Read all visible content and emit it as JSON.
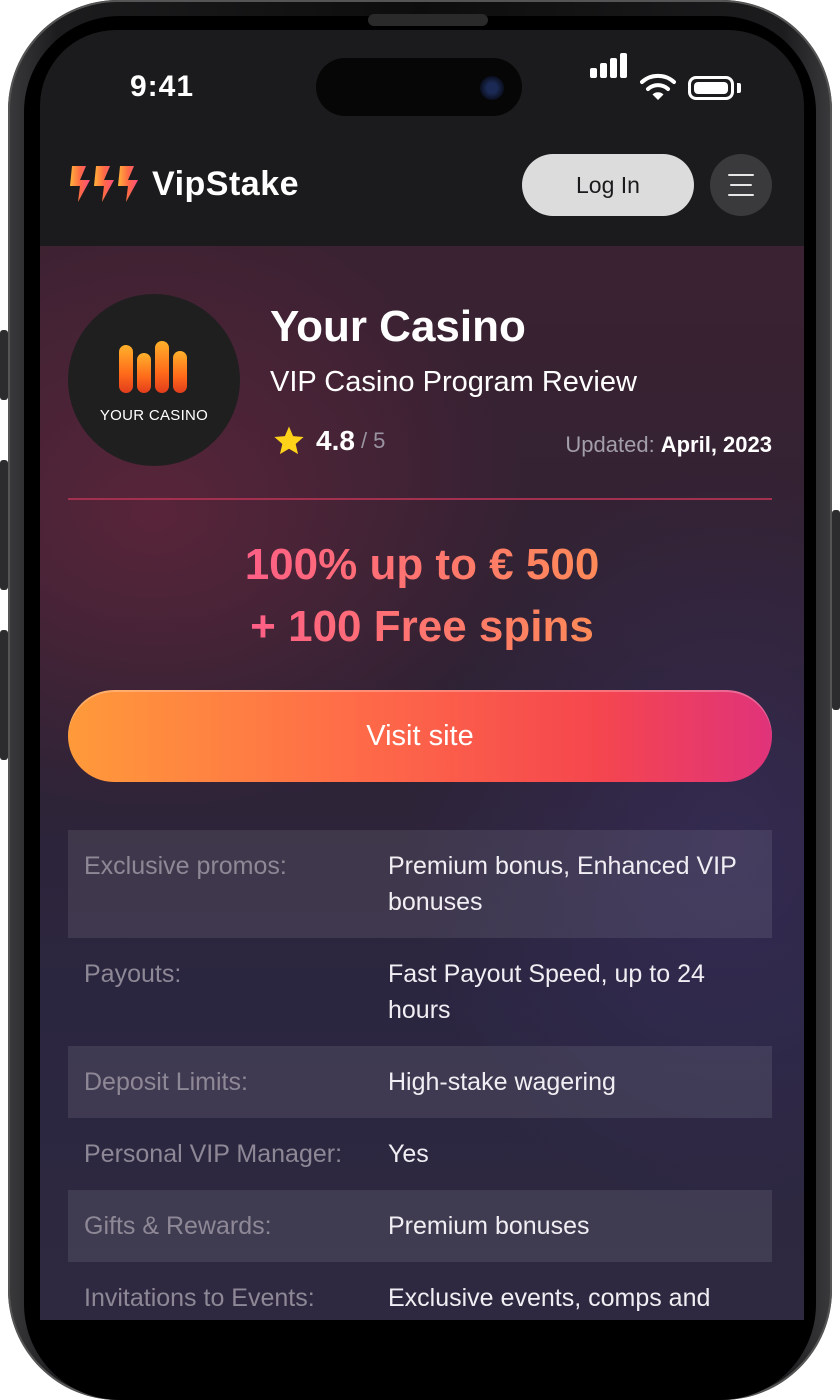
{
  "status_bar": {
    "time": "9:41"
  },
  "header": {
    "brand": "VipStake",
    "login_label": "Log In",
    "menu_icon": "hamburger-menu-icon"
  },
  "casino": {
    "logo_text": "YOUR CASINO",
    "name": "Your Casino",
    "subtitle": "VIP Casino Program Review",
    "rating": "4.8",
    "rating_max": "/ 5",
    "updated_label": "Updated:",
    "updated_value": "April, 2023"
  },
  "bonus": {
    "line1": "100% up to € 500",
    "line2": "+ 100 Free spins"
  },
  "cta": {
    "visit_label": "Visit site"
  },
  "details": [
    {
      "key": "Exclusive promos:",
      "value": "Premium bonus, Enhanced VIP bonuses"
    },
    {
      "key": "Payouts:",
      "value": "Fast Payout Speed, up to 24 hours"
    },
    {
      "key": "Deposit Limits:",
      "value": "High-stake wagering"
    },
    {
      "key": "Personal VIP Manager:",
      "value": "Yes"
    },
    {
      "key": "Gifts & Rewards:",
      "value": "Premium bonuses"
    },
    {
      "key": "Invitations to Events:",
      "value": "Exclusive events, comps and"
    }
  ],
  "colors": {
    "accent_orange": "#ff9a3a",
    "accent_pink": "#e0337a",
    "header_bg": "#1b1b1d",
    "divider": "#a4304f"
  }
}
